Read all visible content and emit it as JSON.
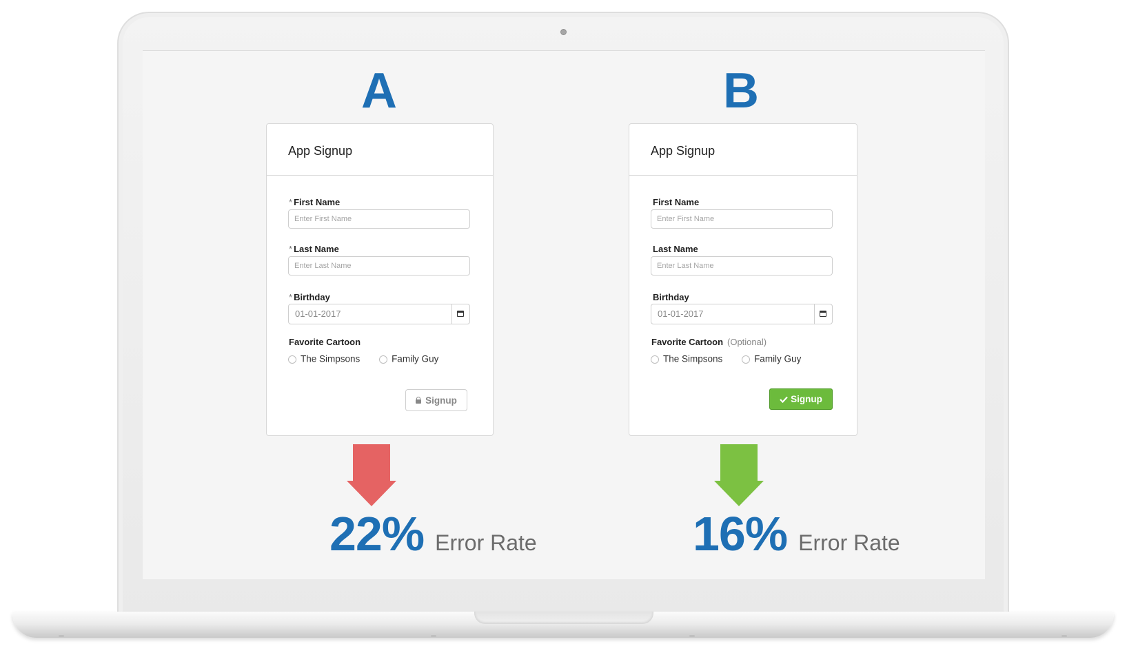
{
  "variants": [
    {
      "letter": "A",
      "form": {
        "title": "App Signup",
        "required_marker": "*",
        "fields": {
          "first_name": {
            "label": "First Name",
            "placeholder": "Enter First Name"
          },
          "last_name": {
            "label": "Last Name",
            "placeholder": "Enter Last Name"
          },
          "birthday": {
            "label": "Birthday",
            "value": "01-01-2017"
          }
        },
        "favorite_cartoon": {
          "label": "Favorite Cartoon",
          "note": "",
          "options": [
            "The Simpsons",
            "Family Guy"
          ]
        },
        "signup_button": {
          "label": "Signup",
          "state": "locked",
          "icon": "lock-icon"
        }
      },
      "arrow": {
        "direction": "down",
        "color": "#e56363"
      },
      "metric": {
        "value": "22%",
        "label": "Error Rate"
      }
    },
    {
      "letter": "B",
      "form": {
        "title": "App Signup",
        "required_marker": "",
        "fields": {
          "first_name": {
            "label": "First Name",
            "placeholder": "Enter First Name"
          },
          "last_name": {
            "label": "Last Name",
            "placeholder": "Enter Last Name"
          },
          "birthday": {
            "label": "Birthday",
            "value": "01-01-2017"
          }
        },
        "favorite_cartoon": {
          "label": "Favorite Cartoon",
          "note": "(Optional)",
          "options": [
            "The Simpsons",
            "Family Guy"
          ]
        },
        "signup_button": {
          "label": "Signup",
          "state": "enabled",
          "icon": "check-icon",
          "color": "#6cbb3c"
        }
      },
      "arrow": {
        "direction": "down",
        "color": "#7cc142"
      },
      "metric": {
        "value": "16%",
        "label": "Error Rate"
      }
    }
  ],
  "colors": {
    "accent": "#1e6fb4",
    "metric_label": "#6c6c6c"
  }
}
